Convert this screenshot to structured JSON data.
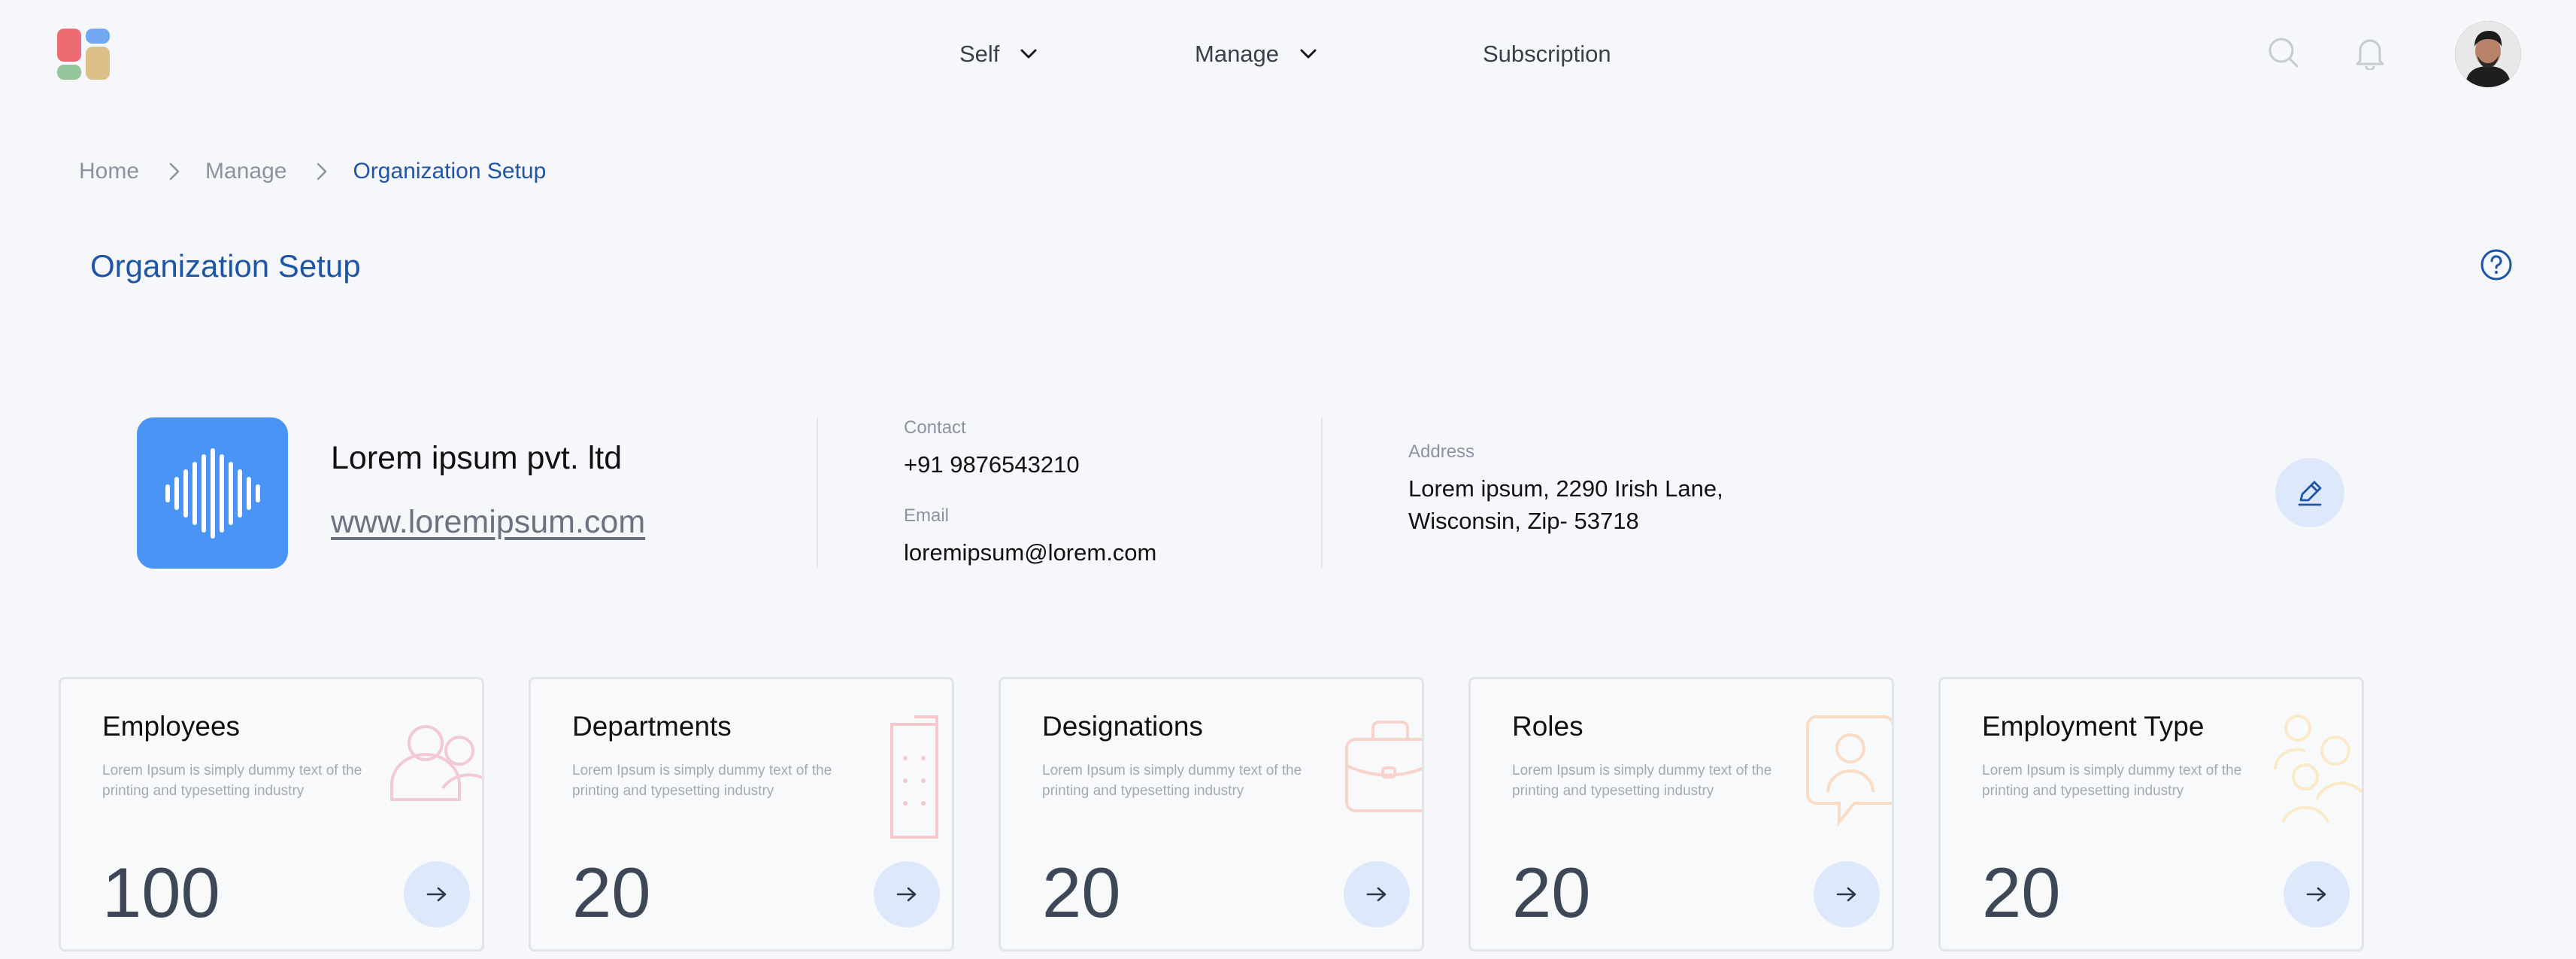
{
  "header": {
    "nav": [
      {
        "label": "Self",
        "has_dropdown": true
      },
      {
        "label": "Manage",
        "has_dropdown": true
      },
      {
        "label": "Subscription",
        "has_dropdown": false
      }
    ],
    "icons": [
      "search-icon",
      "bell-icon",
      "avatar"
    ]
  },
  "breadcrumb": [
    "Home",
    "Manage",
    "Organization Setup"
  ],
  "page_title": "Organization Setup",
  "organization": {
    "name": "Lorem ipsum pvt. ltd",
    "website": "www.loremipsum.com",
    "contact_label": "Contact",
    "contact": "+91 9876543210",
    "email_label": "Email",
    "email": "loremipsum@lorem.com",
    "address_label": "Address",
    "address_line1": "Lorem ipsum, 2290 Irish Lane,",
    "address_line2": "Wisconsin, Zip- 53718"
  },
  "cards": [
    {
      "title": "Employees",
      "description": "Lorem Ipsum is simply dummy text of the printing and typesetting industry",
      "value": "100",
      "icon": "users-icon"
    },
    {
      "title": "Departments",
      "description": "Lorem Ipsum is simply dummy text of the printing and typesetting industry",
      "value": "20",
      "icon": "building-icon"
    },
    {
      "title": "Designations",
      "description": "Lorem Ipsum is simply dummy text of the printing and typesetting industry",
      "value": "20",
      "icon": "briefcase-icon"
    },
    {
      "title": "Roles",
      "description": "Lorem Ipsum is simply dummy text of the printing and typesetting industry",
      "value": "20",
      "icon": "user-role-icon"
    },
    {
      "title": "Employment Type",
      "description": "Lorem Ipsum is simply dummy text of the printing and typesetting industry",
      "value": "20",
      "icon": "team-icon"
    }
  ],
  "colors": {
    "accent": "#1f55a5",
    "org_logo_bg": "#4a94f5",
    "button_bg": "#dde9fb",
    "card_icon_employees": "#f1c9d9",
    "card_icon_departments": "#f6c9cf",
    "card_icon_designations": "#f8d3cc",
    "card_icon_roles": "#f9dcc3",
    "card_icon_employment_type": "#faeac8"
  }
}
